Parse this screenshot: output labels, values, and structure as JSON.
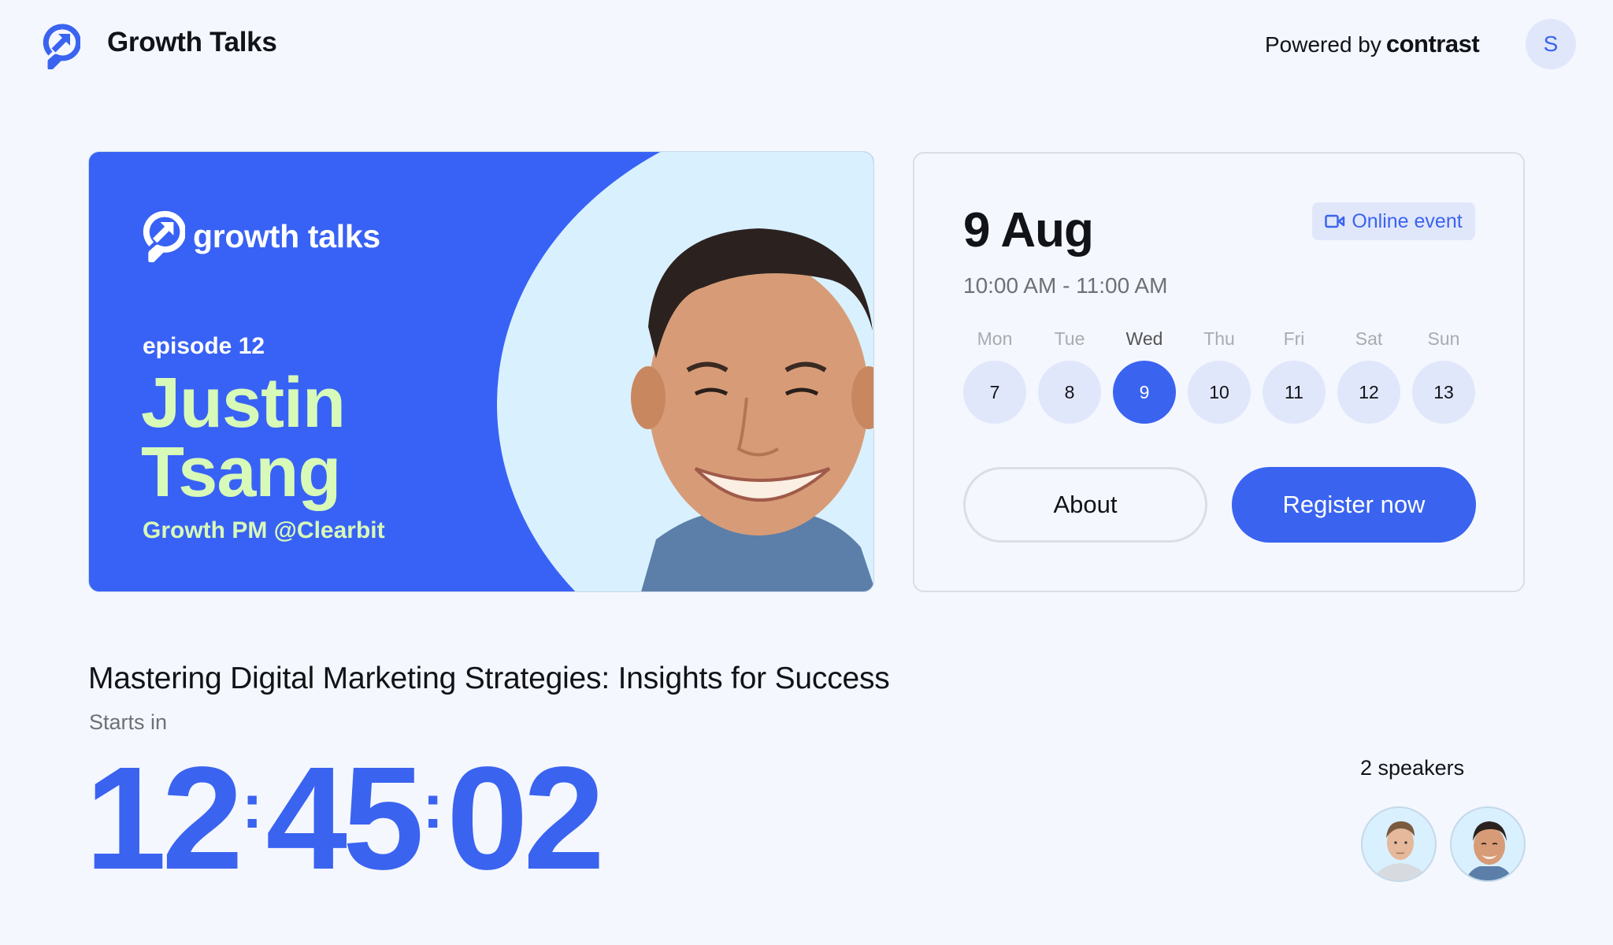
{
  "header": {
    "app_title": "Growth Talks",
    "logo_icon": "growth-talks-logo-icon",
    "powered_by_prefix": "Powered by",
    "powered_by_brand": "contrast",
    "user_avatar_initial": "S"
  },
  "banner": {
    "logo_text": "growth talks",
    "episode": "episode 12",
    "speaker_first_name": "Justin",
    "speaker_last_name": "Tsang",
    "speaker_role": "Growth PM @Clearbit",
    "colors": {
      "background": "#3862f5",
      "accent": "#d8fab8",
      "circle": "#d9f0ff"
    }
  },
  "event": {
    "date": "9 Aug",
    "time_range": "10:00 AM - 11:00 AM",
    "badge_icon": "video-camera-icon",
    "badge_label": "Online event",
    "days": [
      {
        "name": "Mon",
        "number": "7",
        "selected": false
      },
      {
        "name": "Tue",
        "number": "8",
        "selected": false
      },
      {
        "name": "Wed",
        "number": "9",
        "selected": true
      },
      {
        "name": "Thu",
        "number": "10",
        "selected": false
      },
      {
        "name": "Fri",
        "number": "11",
        "selected": false
      },
      {
        "name": "Sat",
        "number": "12",
        "selected": false
      },
      {
        "name": "Sun",
        "number": "13",
        "selected": false
      }
    ],
    "about_label": "About",
    "register_label": "Register now"
  },
  "main": {
    "title": "Mastering Digital Marketing Strategies: Insights for Success",
    "starts_in_label": "Starts in",
    "countdown": {
      "hours": "12",
      "minutes": "45",
      "seconds": "02",
      "separator": ":"
    },
    "speakers_count_label": "2 speakers",
    "speakers": [
      {
        "avatar": "speaker-avatar-1"
      },
      {
        "avatar": "speaker-avatar-2"
      }
    ]
  },
  "colors": {
    "primary": "#3a63f0",
    "page_bg": "#f4f7fe",
    "chip_bg": "#e1e7fb",
    "text": "#111318",
    "muted": "#6e7075"
  }
}
